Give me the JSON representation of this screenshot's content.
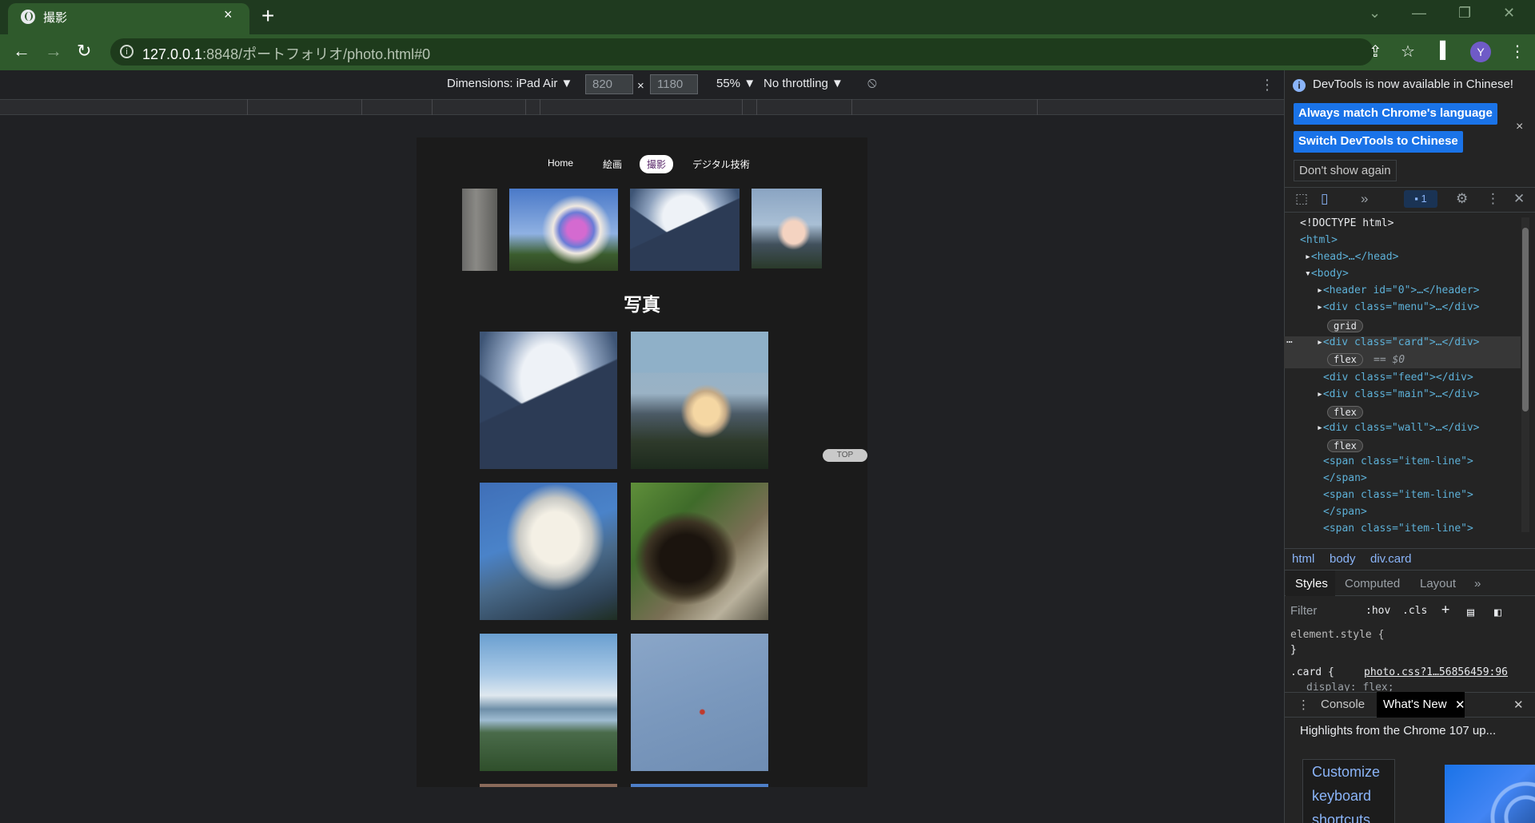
{
  "browser": {
    "tab_title": "撮影",
    "tab_close": "×",
    "new_tab": "+",
    "url_host": "127.0.0.1",
    "url_rest": ":8848/ポートフォリオ/photo.html#0",
    "avatar_letter": "Y",
    "window_controls": [
      "⌄",
      "—",
      "❐",
      "✕"
    ]
  },
  "device_toolbar": {
    "dimensions_label": "Dimensions: iPad Air ▼",
    "width": "820",
    "times": "×",
    "height": "1180",
    "zoom": "55% ▼",
    "throttling": "No throttling ▼"
  },
  "page": {
    "menu": [
      "Home",
      "絵画",
      "撮影",
      "デジタル技術"
    ],
    "active_menu": "撮影",
    "heading": "写真",
    "top_button": "TOP",
    "thumbnails": [
      "wall",
      "ferris-wheel",
      "snowy-mountain",
      "golden-peak"
    ],
    "photos": [
      "snowy-mountain",
      "golden-peak",
      "blue-sky-mountain",
      "forest-cave",
      "lake-landscape",
      "boat-on-water"
    ]
  },
  "devtools": {
    "notice": "DevTools is now available in Chinese!",
    "btn_match": "Always match Chrome's language",
    "btn_switch": "Switch DevTools to Chinese",
    "btn_dont": "Don't show again",
    "close": "×",
    "issues_badge": "1",
    "dom": {
      "doctype": "<!DOCTYPE html>",
      "html": "<html>",
      "head": "<head>…</head>",
      "body": "<body>",
      "header": "<header id=\"0\">…</header>",
      "menu": "<div class=\"menu\">…</div>",
      "pill_grid": "grid",
      "card": "<div class=\"card\">…</div>",
      "pill_flex": "flex",
      "eq": "== $0",
      "feed": "<div class=\"feed\"></div>",
      "main": "<div class=\"main\">…</div>",
      "wall": "<div class=\"wall\">…</div>",
      "span": "<span class=\"item-line\">",
      "span_close": "</span>"
    },
    "breadcrumbs": [
      "html",
      "body",
      "div.card"
    ],
    "style_tabs": [
      "Styles",
      "Computed",
      "Layout",
      "»"
    ],
    "filter_placeholder": "Filter",
    "filter_opts": [
      ":hov",
      ".cls",
      "+"
    ],
    "element_style": "element.style {",
    "close_brace": "}",
    "card_rule": ".card {",
    "card_source": "photo.css?1…56856459:96",
    "display_line": "display: flex;",
    "drawer_tabs": [
      "Console",
      "What's New"
    ],
    "highlights": "Highlights from the Chrome 107 up...",
    "card_links": [
      "Customize",
      "keyboard",
      "shortcuts"
    ]
  }
}
